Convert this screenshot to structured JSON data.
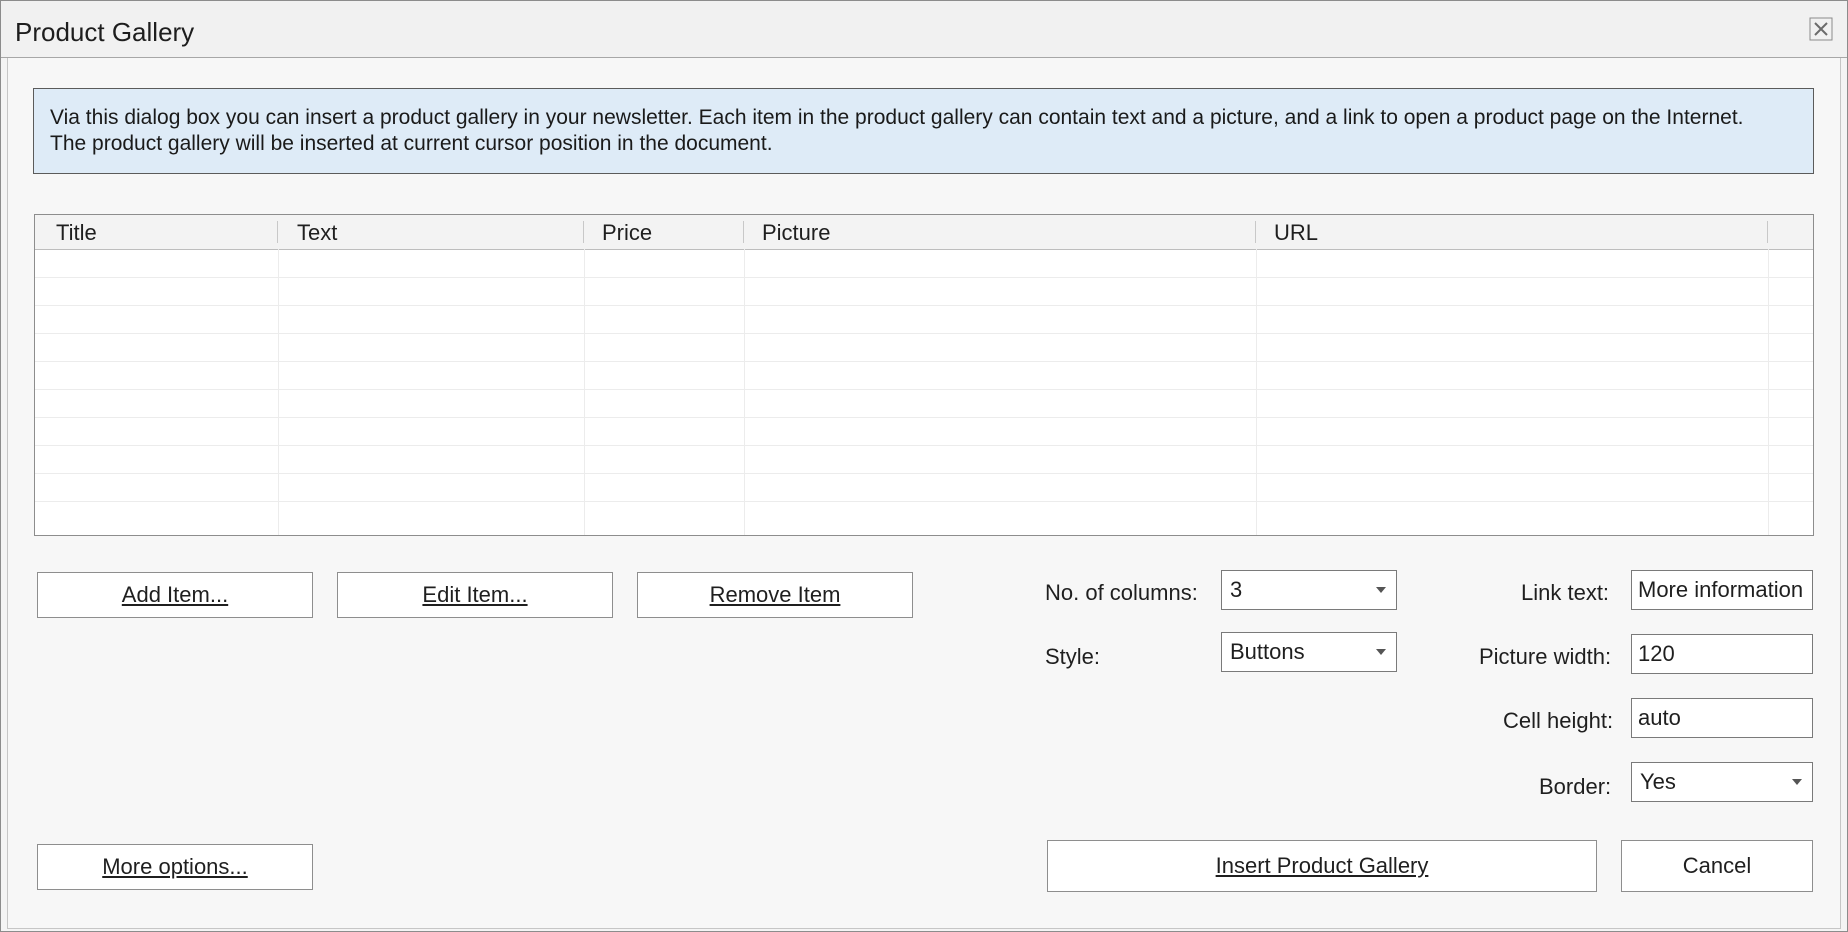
{
  "window": {
    "title": "Product Gallery"
  },
  "info": {
    "line1": "Via this dialog box you can insert a product gallery in your newsletter. Each item in the product gallery can contain text and a picture, and a link to open a product page on the Internet.",
    "line2": "The product gallery will be inserted at current cursor position in the document."
  },
  "grid": {
    "columns": [
      "Title",
      "Text",
      "Price",
      "Picture",
      "URL"
    ]
  },
  "buttons": {
    "add_item": "Add Item...",
    "edit_item": "Edit Item...",
    "remove_item": "Remove Item",
    "more_options": "More options...",
    "insert_gallery": "Insert Product Gallery",
    "cancel": "Cancel"
  },
  "settings": {
    "columns_label": "No. of columns:",
    "columns_value": "3",
    "style_label": "Style:",
    "style_value": "Buttons",
    "link_text_label": "Link text:",
    "link_text_value": "More information",
    "picture_width_label": "Picture width:",
    "picture_width_value": "120",
    "cell_height_label": "Cell height:",
    "cell_height_value": "auto",
    "border_label": "Border:",
    "border_value": "Yes"
  }
}
